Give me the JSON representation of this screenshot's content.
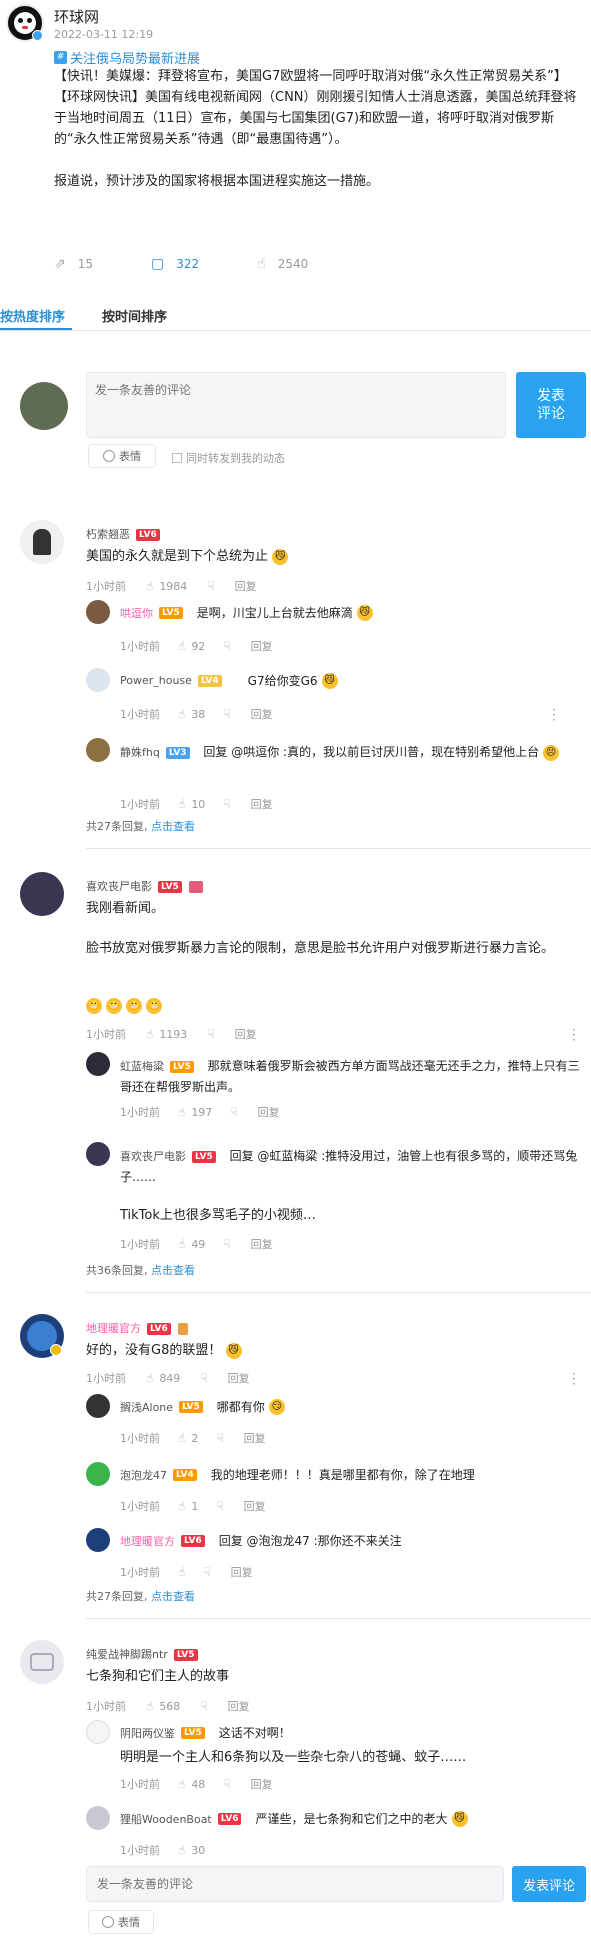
{
  "post": {
    "author": "环球网",
    "time": "2022-03-11 12:19",
    "topic": "关注俄乌局势最新进展",
    "p1": "【快讯！美媒爆：拜登将宣布，美国G7欧盟将一同呼吁取消对俄“永久性正常贸易关系”】",
    "p2": "【环球网快讯】美国有线电视新闻网（CNN）刚刚援引知情人士消息透露，美国总统拜登将于当地时间周五（11日）宣布，美国与七国集团(G7)和欧盟一道，将呼吁取消对俄罗斯的“永久性正常贸易关系”待遇（即“最惠国待遇”）。",
    "p3": "报道说，预计涉及的国家将根据本国进程实施这一措施。",
    "forward": "15",
    "comments": "322",
    "likes": "2540"
  },
  "tabs": {
    "hot": "按热度排序",
    "time": "按时间排序"
  },
  "composer": {
    "placeholder": "发一条友善的评论",
    "submit": "发表\n评论",
    "emoji": "表情",
    "forward_label": "同时转发到我的动态"
  },
  "comments": [
    {
      "user": "朽索翘恶",
      "level": "LV6",
      "text": "美国的永久就是到下个总统为止",
      "time": "1小时前",
      "likes": "1984",
      "reply": "回复",
      "replies": [
        {
          "user": "哄逗你",
          "level": "LV5",
          "text": "是啊，川宝儿上台就去他麻滴",
          "time": "1小时前",
          "likes": "92"
        },
        {
          "user": "Power_house",
          "level": "LV4",
          "text": "G7给你变G6",
          "time": "1小时前",
          "likes": "38"
        },
        {
          "user": "静姝fhq",
          "level": "LV3",
          "text": "回复 @哄逗你 :真的，我以前巨讨厌川普，现在特别希望他上台",
          "time": "1小时前",
          "likes": "10"
        }
      ],
      "more_count": "共27条回复, ",
      "more_link": "点击查看"
    },
    {
      "user": "喜欢丧尸电影",
      "level": "LV5",
      "text1": "我刚看新闻。",
      "text2": "脸书放宽对俄罗斯暴力言论的限制，意思是脸书允许用户对俄罗斯进行暴力言论。",
      "time": "1小时前",
      "likes": "1193",
      "reply": "回复",
      "replies": [
        {
          "user": "虹蓝梅粱",
          "level": "LV5",
          "text": "那就意味着俄罗斯会被西方单方面骂战还毫无还手之力，推特上只有三哥还在帮俄罗斯出声。",
          "time": "1小时前",
          "likes": "197"
        },
        {
          "user": "喜欢丧尸电影",
          "level": "LV5",
          "text": "回复 @虹蓝梅粱 :推特没用过，油管上也有很多骂的，顺带还骂兔子……",
          "text2": "TikTok上也很多骂毛子的小视频…",
          "time": "1小时前",
          "likes": "49"
        }
      ],
      "more_count": "共36条回复, ",
      "more_link": "点击查看"
    },
    {
      "user": "地理暖官方",
      "level": "LV6",
      "text": "好的，没有G8的联盟！",
      "time": "1小时前",
      "likes": "849",
      "reply": "回复",
      "replies": [
        {
          "user": "搁浅Alone",
          "level": "LV5",
          "text": "哪都有你",
          "time": "1小时前",
          "likes": "2"
        },
        {
          "user": "泡泡龙47",
          "level": "LV4",
          "text": "我的地理老师！！！真是哪里都有你，除了在地理",
          "time": "1小时前",
          "likes": "1"
        },
        {
          "user": "地理暖官方",
          "level": "LV6",
          "text": "回复 @泡泡龙47 :那你还不来关注",
          "time": "1小时前",
          "likes": ""
        }
      ],
      "more_count": "共27条回复, ",
      "more_link": "点击查看"
    },
    {
      "user": "纯爱战神脚踢ntr",
      "level": "LV5",
      "text": "七条狗和它们主人的故事",
      "time": "1小时前",
      "likes": "568",
      "reply": "回复",
      "replies": [
        {
          "user": "阴阳两仪鉴",
          "level": "LV5",
          "text": "这话不对啊！",
          "text2": "明明是一个主人和6条狗以及一些杂七杂八的苍蝇、蚊子……",
          "time": "1小时前",
          "likes": "48"
        },
        {
          "user": "狸船WoodenBoat",
          "level": "LV6",
          "text": "严谨些，是七条狗和它们之中的老大",
          "time": "1小时前",
          "likes": "30"
        }
      ]
    }
  ],
  "bottom": {
    "placeholder": "发一条友善的评论",
    "submit": "发表评论",
    "emoji": "表情"
  }
}
